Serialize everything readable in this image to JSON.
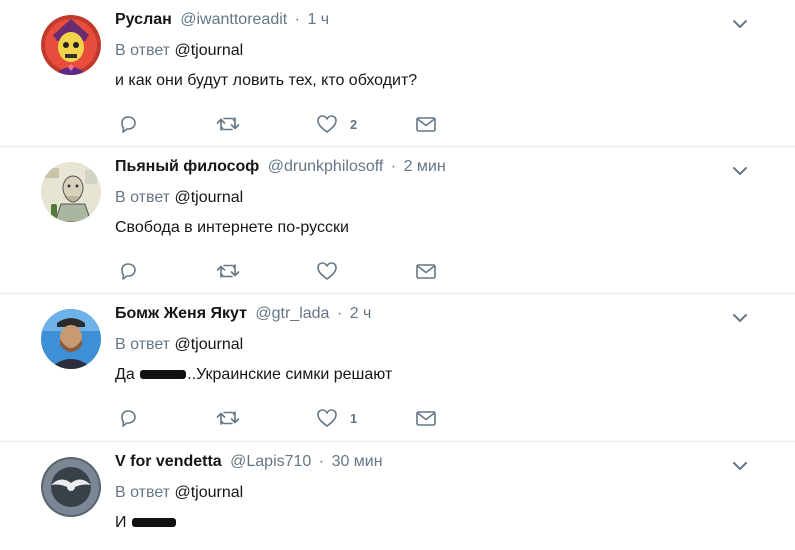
{
  "tweets": [
    {
      "name": "Руслан",
      "handle": "@iwanttoreadit",
      "separator": "·",
      "time": "1 ч",
      "reply_prefix": "В ответ",
      "reply_to": "@tjournal",
      "text_before": "и как они будут ловить тех, кто обходит?",
      "text_after": "",
      "like_count": "2",
      "avatar_icon": "skeletor-avatar"
    },
    {
      "name": "Пьяный философ",
      "handle": "@drunkphilosoff",
      "separator": "·",
      "time": "2 мин",
      "reply_prefix": "В ответ",
      "reply_to": "@tjournal",
      "text_before": "Свобода в интернете по-русски",
      "text_after": "",
      "like_count": "",
      "avatar_icon": "sketch-avatar"
    },
    {
      "name": "Бомж Женя Якут",
      "handle": "@gtr_lada",
      "separator": "·",
      "time": "2 ч",
      "reply_prefix": "В ответ",
      "reply_to": "@tjournal",
      "text_before": "Да",
      "text_after": "..Украинские симки решают",
      "like_count": "1",
      "avatar_icon": "photo-avatar"
    },
    {
      "name": "V for vendetta",
      "handle": "@Lapis710",
      "separator": "·",
      "time": "30 мин",
      "reply_prefix": "В ответ",
      "reply_to": "@tjournal",
      "text_before": "И",
      "text_after": "",
      "like_count": "",
      "avatar_icon": "emblem-avatar"
    }
  ],
  "colors": {
    "secondary_text": "#657786",
    "primary_text": "#14171a",
    "divider": "#e6ecf0"
  }
}
